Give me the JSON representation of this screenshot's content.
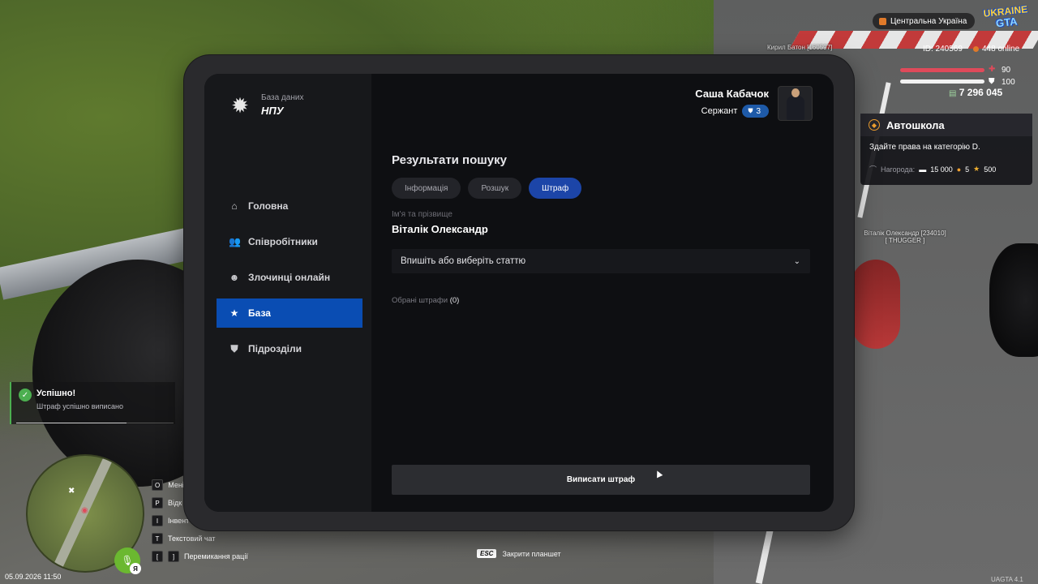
{
  "hud": {
    "region": "Центральна Україна",
    "logo_top": "UKRAINE",
    "logo_bottom": "GTA",
    "id": "ID: 240569",
    "online": "448 online",
    "health": "90",
    "armor": "100",
    "money": "7 296 045",
    "health_fraction": 1.0,
    "armor_fraction": 1.0
  },
  "nameplates": {
    "top": "Кирил Батон [160597]",
    "player_name": "Віталік Олександр [234010]",
    "player_tag": "[ THUGGER ]"
  },
  "quest": {
    "title": "Автошкола",
    "description": "Здайте права на категорію D.",
    "reward_label": "Нагорода:",
    "reward_money": "15 000",
    "reward_coins": "5",
    "reward_stars": "500"
  },
  "notification": {
    "title": "Успішно!",
    "text": "Штраф успішно виписано",
    "progress": 0.7
  },
  "bottom": {
    "datetime": "05.09.2026 11:50",
    "mic_badge": "Я",
    "keys": [
      {
        "key": "O",
        "label": "Мені"
      },
      {
        "key": "P",
        "label": "Відк"
      },
      {
        "key": "I",
        "label": "Інвент"
      },
      {
        "key": "T",
        "label": "Текстовий чат"
      }
    ],
    "radio_key_1": "[",
    "radio_key_2": "]",
    "radio_label": "Перемикання рації",
    "esc_key": "ESC",
    "esc_label": "Закрити планшет",
    "version": "UAGTA 4.1"
  },
  "tablet": {
    "brand_sub": "База даних",
    "brand_title": "НПУ",
    "profile": {
      "name": "Саша Кабачок",
      "rank": "Сержант",
      "rank_level": "3"
    },
    "nav": [
      {
        "label": "Головна",
        "icon": "home-icon"
      },
      {
        "label": "Співробітники",
        "icon": "users-icon"
      },
      {
        "label": "Злочинці онлайн",
        "icon": "mask-icon"
      },
      {
        "label": "База",
        "icon": "star-icon",
        "active": true
      },
      {
        "label": "Підрозділи",
        "icon": "shield-icon"
      }
    ],
    "results_title": "Результати пошуку",
    "tabs": [
      "Інформація",
      "Розшук",
      "Штраф"
    ],
    "active_tab": "Штраф",
    "field_label": "Ім'я та прізвище",
    "field_value": "Віталік Олександр",
    "select_placeholder": "Впишіть або виберіть статтю",
    "selected_label": "Обрані штрафи",
    "selected_count": "(0)",
    "submit_label": "Виписати штраф"
  }
}
